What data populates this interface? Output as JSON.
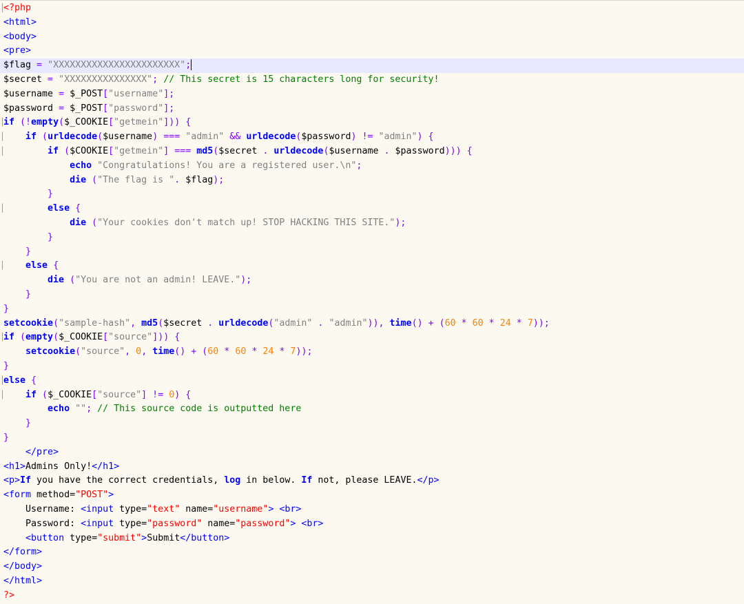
{
  "editor": {
    "lines": [
      {
        "segments": [
          {
            "t": "<?php",
            "c": "php"
          }
        ]
      },
      {
        "segments": [
          {
            "t": "<html>",
            "c": "tag"
          }
        ]
      },
      {
        "segments": [
          {
            "t": "<body>",
            "c": "tag"
          }
        ]
      },
      {
        "segments": [
          {
            "t": "<pre>",
            "c": "tag"
          }
        ]
      },
      {
        "segments": [
          {
            "t": "$flag",
            "c": "var"
          },
          {
            "t": " = ",
            "c": "op"
          },
          {
            "t": "\"XXXXXXXXXXXXXXXXXXXXXXX\"",
            "c": "str"
          },
          {
            "t": ";",
            "c": "op"
          }
        ],
        "current": true,
        "caret": true
      },
      {
        "segments": [
          {
            "t": "$secret",
            "c": "var"
          },
          {
            "t": " = ",
            "c": "op"
          },
          {
            "t": "\"XXXXXXXXXXXXXXX\"",
            "c": "str"
          },
          {
            "t": "; ",
            "c": "op"
          },
          {
            "t": "// This secret is 15 characters long for security!",
            "c": "cmt"
          }
        ]
      },
      {
        "segments": [
          {
            "t": "$username",
            "c": "var"
          },
          {
            "t": " = ",
            "c": "op"
          },
          {
            "t": "$_POST",
            "c": "var"
          },
          {
            "t": "[",
            "c": "op"
          },
          {
            "t": "\"username\"",
            "c": "str"
          },
          {
            "t": "];",
            "c": "op"
          }
        ]
      },
      {
        "segments": [
          {
            "t": "$password",
            "c": "var"
          },
          {
            "t": " = ",
            "c": "op"
          },
          {
            "t": "$_POST",
            "c": "var"
          },
          {
            "t": "[",
            "c": "op"
          },
          {
            "t": "\"password\"",
            "c": "str"
          },
          {
            "t": "];",
            "c": "op"
          }
        ]
      },
      {
        "segments": [
          {
            "t": "if",
            "c": "kw"
          },
          {
            "t": " (!",
            "c": "op"
          },
          {
            "t": "empty",
            "c": "kw"
          },
          {
            "t": "(",
            "c": "op"
          },
          {
            "t": "$_COOKIE",
            "c": "var"
          },
          {
            "t": "[",
            "c": "op"
          },
          {
            "t": "\"getmein\"",
            "c": "str"
          },
          {
            "t": "])) {",
            "c": "op"
          }
        ]
      },
      {
        "segments": [
          {
            "t": "    "
          },
          {
            "t": "if",
            "c": "kw"
          },
          {
            "t": " (",
            "c": "op"
          },
          {
            "t": "urldecode",
            "c": "kw"
          },
          {
            "t": "(",
            "c": "op"
          },
          {
            "t": "$username",
            "c": "var"
          },
          {
            "t": ") === ",
            "c": "op"
          },
          {
            "t": "\"admin\"",
            "c": "str"
          },
          {
            "t": " && ",
            "c": "op"
          },
          {
            "t": "urldecode",
            "c": "kw"
          },
          {
            "t": "(",
            "c": "op"
          },
          {
            "t": "$password",
            "c": "var"
          },
          {
            "t": ") != ",
            "c": "op"
          },
          {
            "t": "\"admin\"",
            "c": "str"
          },
          {
            "t": ") {",
            "c": "op"
          }
        ]
      },
      {
        "segments": [
          {
            "t": "        "
          },
          {
            "t": "if",
            "c": "kw"
          },
          {
            "t": " (",
            "c": "op"
          },
          {
            "t": "$COOKIE",
            "c": "var"
          },
          {
            "t": "[",
            "c": "op"
          },
          {
            "t": "\"getmein\"",
            "c": "str"
          },
          {
            "t": "] === ",
            "c": "op"
          },
          {
            "t": "md5",
            "c": "kw"
          },
          {
            "t": "(",
            "c": "op"
          },
          {
            "t": "$secret",
            "c": "var"
          },
          {
            "t": " . ",
            "c": "op"
          },
          {
            "t": "urldecode",
            "c": "kw"
          },
          {
            "t": "(",
            "c": "op"
          },
          {
            "t": "$username",
            "c": "var"
          },
          {
            "t": " . ",
            "c": "op"
          },
          {
            "t": "$password",
            "c": "var"
          },
          {
            "t": "))) {",
            "c": "op"
          }
        ]
      },
      {
        "segments": [
          {
            "t": "            "
          },
          {
            "t": "echo",
            "c": "kw"
          },
          {
            "t": " "
          },
          {
            "t": "\"Congratulations! You are a registered user.\\n\"",
            "c": "str"
          },
          {
            "t": ";",
            "c": "op"
          }
        ]
      },
      {
        "segments": [
          {
            "t": "            "
          },
          {
            "t": "die",
            "c": "kw"
          },
          {
            "t": " (",
            "c": "op"
          },
          {
            "t": "\"The flag is \"",
            "c": "str"
          },
          {
            "t": ". ",
            "c": "op"
          },
          {
            "t": "$flag",
            "c": "var"
          },
          {
            "t": ");",
            "c": "op"
          }
        ]
      },
      {
        "segments": [
          {
            "t": "        "
          },
          {
            "t": "}",
            "c": "op"
          }
        ]
      },
      {
        "segments": [
          {
            "t": "        "
          },
          {
            "t": "else",
            "c": "kw"
          },
          {
            "t": " {",
            "c": "op"
          }
        ]
      },
      {
        "segments": [
          {
            "t": "            "
          },
          {
            "t": "die",
            "c": "kw"
          },
          {
            "t": " (",
            "c": "op"
          },
          {
            "t": "\"Your cookies don't match up! STOP HACKING THIS SITE.\"",
            "c": "str"
          },
          {
            "t": ");",
            "c": "op"
          }
        ]
      },
      {
        "segments": [
          {
            "t": "        "
          },
          {
            "t": "}",
            "c": "op"
          }
        ]
      },
      {
        "segments": [
          {
            "t": "    "
          },
          {
            "t": "}",
            "c": "op"
          }
        ]
      },
      {
        "segments": [
          {
            "t": "    "
          },
          {
            "t": "else",
            "c": "kw"
          },
          {
            "t": " {",
            "c": "op"
          }
        ]
      },
      {
        "segments": [
          {
            "t": "        "
          },
          {
            "t": "die",
            "c": "kw"
          },
          {
            "t": " (",
            "c": "op"
          },
          {
            "t": "\"You are not an admin! LEAVE.\"",
            "c": "str"
          },
          {
            "t": ");",
            "c": "op"
          }
        ]
      },
      {
        "segments": [
          {
            "t": "    "
          },
          {
            "t": "}",
            "c": "op"
          }
        ]
      },
      {
        "segments": [
          {
            "t": "}",
            "c": "op"
          }
        ]
      },
      {
        "segments": [
          {
            "t": "setcookie",
            "c": "kw"
          },
          {
            "t": "(",
            "c": "op"
          },
          {
            "t": "\"sample-hash\"",
            "c": "str"
          },
          {
            "t": ", ",
            "c": "op"
          },
          {
            "t": "md5",
            "c": "kw"
          },
          {
            "t": "(",
            "c": "op"
          },
          {
            "t": "$secret",
            "c": "var"
          },
          {
            "t": " . ",
            "c": "op"
          },
          {
            "t": "urldecode",
            "c": "kw"
          },
          {
            "t": "(",
            "c": "op"
          },
          {
            "t": "\"admin\"",
            "c": "str"
          },
          {
            "t": " . ",
            "c": "op"
          },
          {
            "t": "\"admin\"",
            "c": "str"
          },
          {
            "t": ")), ",
            "c": "op"
          },
          {
            "t": "time",
            "c": "kw"
          },
          {
            "t": "() + (",
            "c": "op"
          },
          {
            "t": "60",
            "c": "num"
          },
          {
            "t": " * ",
            "c": "op"
          },
          {
            "t": "60",
            "c": "num"
          },
          {
            "t": " * ",
            "c": "op"
          },
          {
            "t": "24",
            "c": "num"
          },
          {
            "t": " * ",
            "c": "op"
          },
          {
            "t": "7",
            "c": "num"
          },
          {
            "t": "));",
            "c": "op"
          }
        ]
      },
      {
        "segments": [
          {
            "t": "if",
            "c": "kw"
          },
          {
            "t": " (",
            "c": "op"
          },
          {
            "t": "empty",
            "c": "kw"
          },
          {
            "t": "(",
            "c": "op"
          },
          {
            "t": "$_COOKIE",
            "c": "var"
          },
          {
            "t": "[",
            "c": "op"
          },
          {
            "t": "\"source\"",
            "c": "str"
          },
          {
            "t": "])) {",
            "c": "op"
          }
        ]
      },
      {
        "segments": [
          {
            "t": "    "
          },
          {
            "t": "setcookie",
            "c": "kw"
          },
          {
            "t": "(",
            "c": "op"
          },
          {
            "t": "\"source\"",
            "c": "str"
          },
          {
            "t": ", ",
            "c": "op"
          },
          {
            "t": "0",
            "c": "num"
          },
          {
            "t": ", ",
            "c": "op"
          },
          {
            "t": "time",
            "c": "kw"
          },
          {
            "t": "() + (",
            "c": "op"
          },
          {
            "t": "60",
            "c": "num"
          },
          {
            "t": " * ",
            "c": "op"
          },
          {
            "t": "60",
            "c": "num"
          },
          {
            "t": " * ",
            "c": "op"
          },
          {
            "t": "24",
            "c": "num"
          },
          {
            "t": " * ",
            "c": "op"
          },
          {
            "t": "7",
            "c": "num"
          },
          {
            "t": "));",
            "c": "op"
          }
        ]
      },
      {
        "segments": [
          {
            "t": "}",
            "c": "op"
          }
        ]
      },
      {
        "segments": [
          {
            "t": "else",
            "c": "kw"
          },
          {
            "t": " {",
            "c": "op"
          }
        ]
      },
      {
        "segments": [
          {
            "t": "    "
          },
          {
            "t": "if",
            "c": "kw"
          },
          {
            "t": " (",
            "c": "op"
          },
          {
            "t": "$_COOKIE",
            "c": "var"
          },
          {
            "t": "[",
            "c": "op"
          },
          {
            "t": "\"source\"",
            "c": "str"
          },
          {
            "t": "] != ",
            "c": "op"
          },
          {
            "t": "0",
            "c": "num"
          },
          {
            "t": ") {",
            "c": "op"
          }
        ]
      },
      {
        "segments": [
          {
            "t": "        "
          },
          {
            "t": "echo",
            "c": "kw"
          },
          {
            "t": " "
          },
          {
            "t": "\"\"",
            "c": "str"
          },
          {
            "t": "; ",
            "c": "op"
          },
          {
            "t": "// This source code is outputted here",
            "c": "cmt"
          }
        ]
      },
      {
        "segments": [
          {
            "t": "    "
          },
          {
            "t": "}",
            "c": "op"
          }
        ]
      },
      {
        "segments": [
          {
            "t": "}",
            "c": "op"
          }
        ]
      },
      {
        "segments": [
          {
            "t": "    "
          },
          {
            "t": "</pre>",
            "c": "tag"
          }
        ]
      },
      {
        "segments": [
          {
            "t": "<h1>",
            "c": "tag"
          },
          {
            "t": "Admins Only!"
          },
          {
            "t": "</h1>",
            "c": "tag"
          }
        ]
      },
      {
        "segments": [
          {
            "t": "<p>",
            "c": "tag"
          },
          {
            "t": "If",
            "c": "kw"
          },
          {
            "t": " you have the correct credentials, "
          },
          {
            "t": "log",
            "c": "kw"
          },
          {
            "t": " in below. "
          },
          {
            "t": "If",
            "c": "kw"
          },
          {
            "t": " not, please LEAVE."
          },
          {
            "t": "</p>",
            "c": "tag"
          }
        ]
      },
      {
        "segments": [
          {
            "t": "<form",
            "c": "tag"
          },
          {
            "t": " method="
          },
          {
            "t": "\"POST\"",
            "c": "attr"
          },
          {
            "t": ">",
            "c": "tag"
          }
        ]
      },
      {
        "segments": [
          {
            "t": "    Username: "
          },
          {
            "t": "<input",
            "c": "tag"
          },
          {
            "t": " type="
          },
          {
            "t": "\"text\"",
            "c": "attr"
          },
          {
            "t": " name="
          },
          {
            "t": "\"username\"",
            "c": "attr"
          },
          {
            "t": ">",
            "c": "tag"
          },
          {
            "t": " "
          },
          {
            "t": "<br>",
            "c": "tag"
          }
        ]
      },
      {
        "segments": [
          {
            "t": "    Password: "
          },
          {
            "t": "<input",
            "c": "tag"
          },
          {
            "t": " type="
          },
          {
            "t": "\"password\"",
            "c": "attr"
          },
          {
            "t": " name="
          },
          {
            "t": "\"password\"",
            "c": "attr"
          },
          {
            "t": ">",
            "c": "tag"
          },
          {
            "t": " "
          },
          {
            "t": "<br>",
            "c": "tag"
          }
        ]
      },
      {
        "segments": [
          {
            "t": "    "
          },
          {
            "t": "<button",
            "c": "tag"
          },
          {
            "t": " type="
          },
          {
            "t": "\"submit\"",
            "c": "attr"
          },
          {
            "t": ">",
            "c": "tag"
          },
          {
            "t": "Submit"
          },
          {
            "t": "</button>",
            "c": "tag"
          }
        ]
      },
      {
        "segments": [
          {
            "t": "</form>",
            "c": "tag"
          }
        ]
      },
      {
        "segments": [
          {
            "t": "</body>",
            "c": "tag"
          }
        ]
      },
      {
        "segments": [
          {
            "t": "</html>",
            "c": "tag"
          }
        ]
      },
      {
        "segments": [
          {
            "t": "?>",
            "c": "php"
          }
        ]
      }
    ]
  },
  "colors": {
    "background": "#fcfaf0",
    "current_line": "#e8e8ff",
    "keyword": "#0000ff",
    "string": "#808080",
    "number": "#ff8000",
    "operator": "#8000ff",
    "comment": "#008000",
    "php_tag": "#ff0000"
  }
}
